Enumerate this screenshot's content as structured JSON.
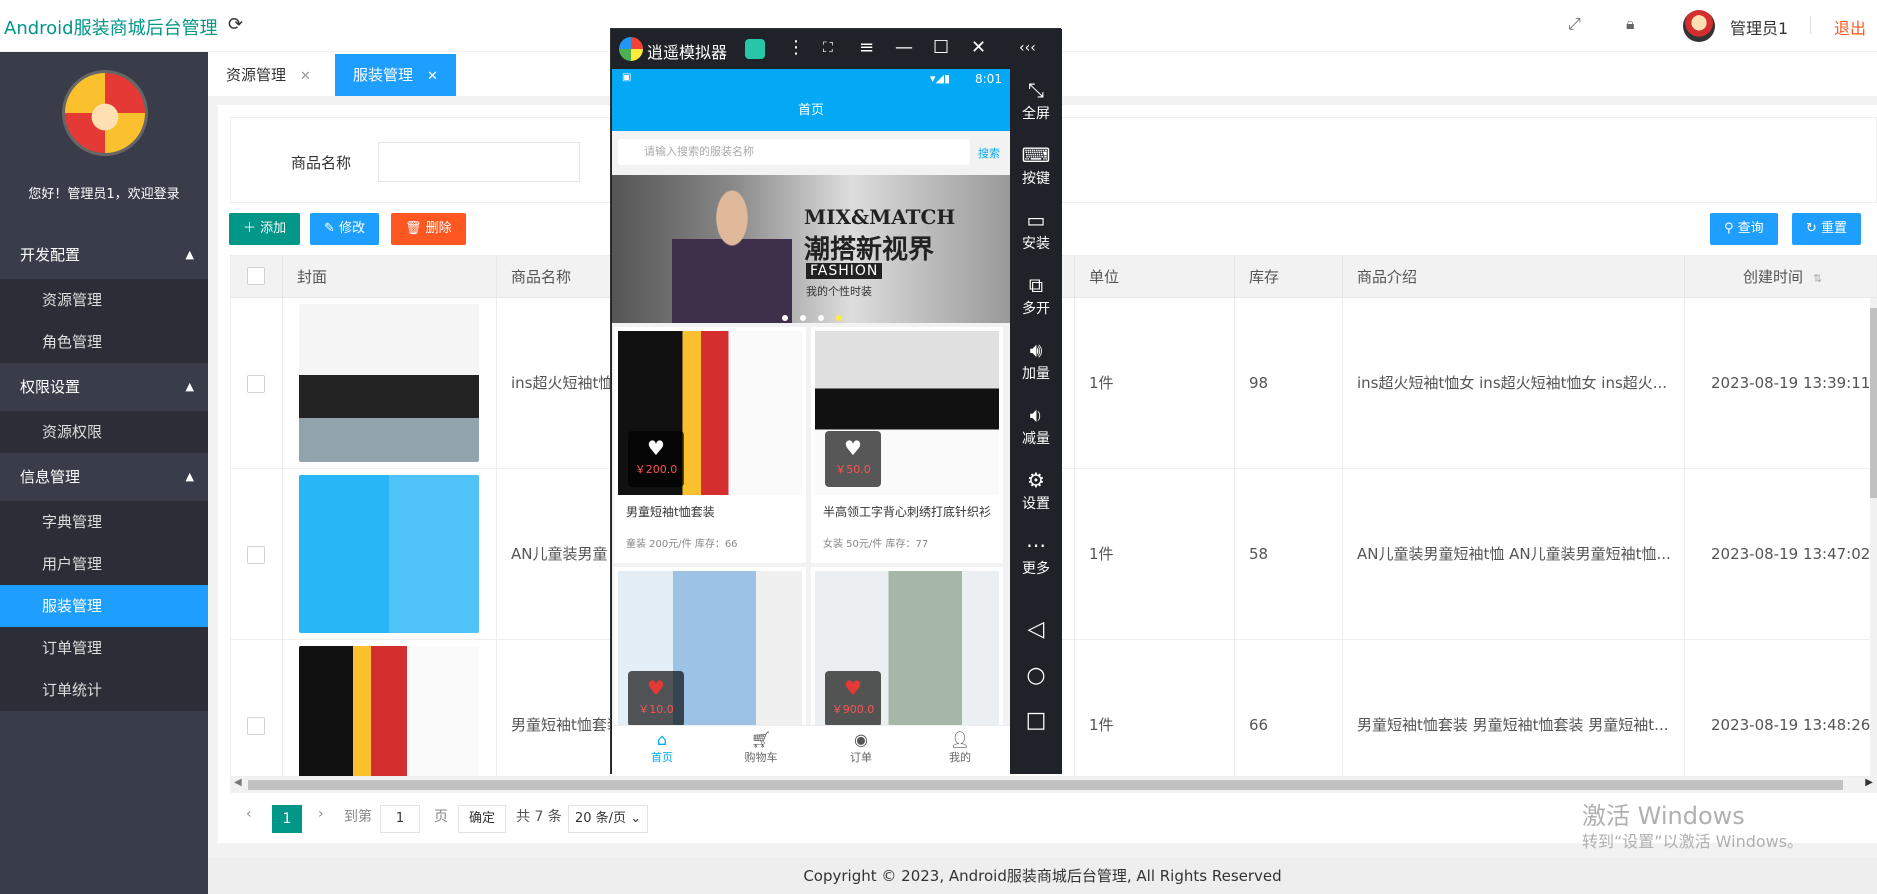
{
  "header": {
    "title": "Android服装商城后台管理",
    "refresh_icon": "refresh-icon",
    "user_name": "管理员1",
    "logout": "退出"
  },
  "sidebar": {
    "welcome": "您好！管理员1，欢迎登录",
    "groups": [
      {
        "label": "开发配置",
        "items": [
          "资源管理",
          "角色管理"
        ]
      },
      {
        "label": "权限设置",
        "items": [
          "资源权限"
        ]
      },
      {
        "label": "信息管理",
        "items": [
          "字典管理",
          "用户管理",
          "服装管理",
          "订单管理",
          "订单统计"
        ]
      }
    ],
    "active_item": "服装管理"
  },
  "tabs": [
    {
      "label": "资源管理",
      "active": false
    },
    {
      "label": "服装管理",
      "active": true
    }
  ],
  "search": {
    "label": "商品名称",
    "value": ""
  },
  "toolbar": {
    "add": "添加",
    "edit": "修改",
    "delete": "删除",
    "query": "查询",
    "reset": "重置"
  },
  "table": {
    "columns": [
      "封面",
      "商品名称",
      "单位",
      "库存",
      "商品介绍",
      "创建时间"
    ],
    "rows": [
      {
        "name": "ins超火短袖t恤",
        "unit": "1件",
        "stock": "98",
        "intro": "ins超火短袖t恤女 ins超火短袖t恤女 ins超火...",
        "created": "2023-08-19 13:39:11"
      },
      {
        "name": "AN儿童装男童",
        "unit": "1件",
        "stock": "58",
        "intro": "AN儿童装男童短袖t恤 AN儿童装男童短袖t恤...",
        "created": "2023-08-19 13:47:02"
      },
      {
        "name": "男童短袖t恤套装",
        "unit": "1件",
        "stock": "66",
        "intro": "男童短袖t恤套装 男童短袖t恤套装 男童短袖t...",
        "created": "2023-08-19 13:48:26"
      }
    ]
  },
  "pagination": {
    "current": "1",
    "goto_label": "到第",
    "goto_value": "1",
    "page_unit": "页",
    "confirm": "确定",
    "total": "共 7 条",
    "page_size": "20 条/页"
  },
  "footer": "Copyright © 2023, Android服装商城后台管理, All Rights Reserved",
  "watermark": {
    "line1": "激活 Windows",
    "line2": "转到“设置”以激活 Windows。"
  },
  "emulator": {
    "title": "逍遥模拟器",
    "status_time": "8:01",
    "app_title": "首页",
    "search_placeholder": "请输入搜索的服装名称",
    "search_btn": "搜索",
    "banner": {
      "line1": "MIX&MATCH",
      "line2": "潮搭新视界",
      "line3": "FASHION",
      "line4": "我的个性时装"
    },
    "products": [
      {
        "title": "男童短袖t恤套装",
        "sub": "童装  200元/件 库存：66",
        "price": "￥200.0"
      },
      {
        "title": "半高领工字背心刺绣打底针织衫",
        "sub": "女装  50元/件 库存：77",
        "price": "￥50.0"
      },
      {
        "title": "",
        "sub": "",
        "price": "￥10.0"
      },
      {
        "title": "",
        "sub": "",
        "price": "￥900.0"
      }
    ],
    "nav": [
      "首页",
      "购物车",
      "订单",
      "我的"
    ],
    "tools": [
      "全屏",
      "按键",
      "安装",
      "多开",
      "加量",
      "减量",
      "设置",
      "更多"
    ]
  },
  "colors": {
    "primary": "#009688",
    "accent": "#1e9fff",
    "danger": "#ff5722",
    "sidebar": "#393d49",
    "phone_accent": "#03a9f4"
  }
}
